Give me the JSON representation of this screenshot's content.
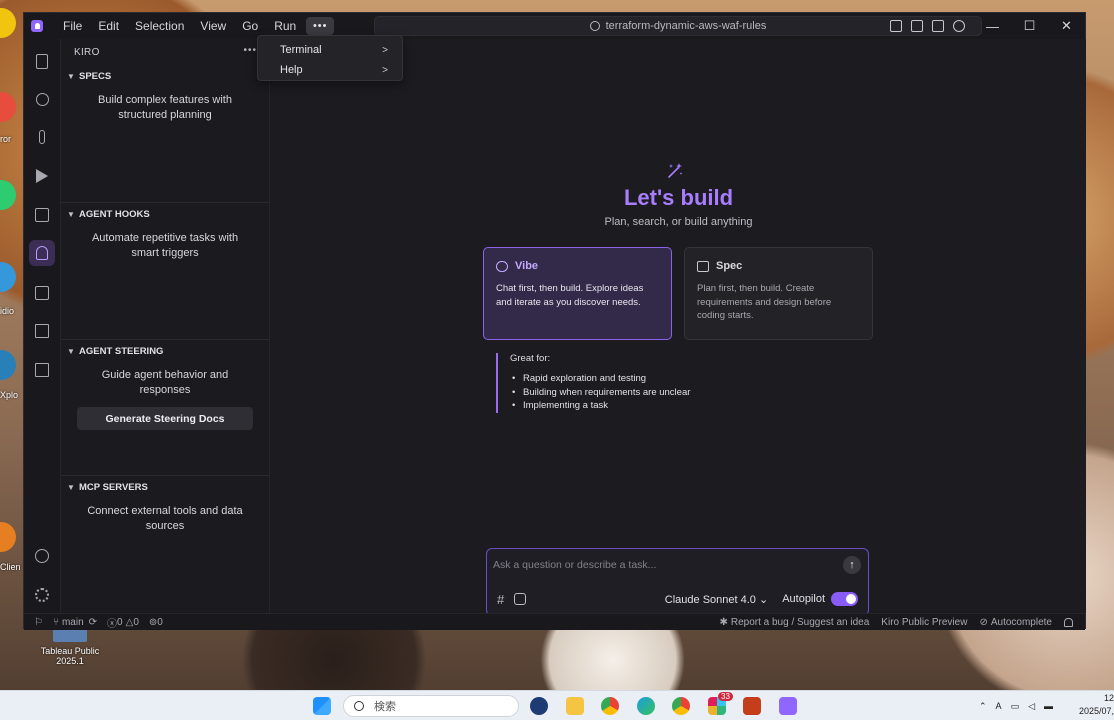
{
  "desktop": {
    "labels": [
      "Tableau Public",
      "2025.1",
      "Clien",
      "idio",
      "Xplo",
      "ror"
    ]
  },
  "titlebar": {
    "menu": [
      "File",
      "Edit",
      "Selection",
      "View",
      "Go",
      "Run"
    ],
    "more": "•••",
    "search_text": "terraform-dynamic-aws-waf-rules",
    "back": "←",
    "forward": "→",
    "minimize": "—",
    "maximize": "☐",
    "close": "✕"
  },
  "dropdown": {
    "items": [
      {
        "label": "Terminal",
        "arrow": ">"
      },
      {
        "label": "Help",
        "arrow": ">"
      }
    ]
  },
  "sidebar": {
    "title": "KIRO",
    "more": "•••",
    "sections": [
      {
        "title": "SPECS",
        "desc": "Build complex features with structured planning"
      },
      {
        "title": "AGENT HOOKS",
        "desc": "Automate repetitive tasks with smart triggers"
      },
      {
        "title": "AGENT STEERING",
        "desc": "Guide agent behavior and responses",
        "button": "Generate Steering Docs"
      },
      {
        "title": "MCP SERVERS",
        "desc": "Connect external tools and data sources"
      }
    ]
  },
  "editor": {
    "headline": "Let's build",
    "subtitle": "Plan, search, or build anything",
    "cards": {
      "vibe": {
        "title": "Vibe",
        "desc": "Chat first, then build. Explore ideas and iterate as you discover needs."
      },
      "spec": {
        "title": "Spec",
        "desc": "Plan first, then build. Create requirements and design before coding starts."
      }
    },
    "great_for": {
      "title": "Great for:",
      "items": [
        "Rapid exploration and testing",
        "Building when requirements are unclear",
        "Implementing a task"
      ]
    },
    "chat": {
      "placeholder": "Ask a question or describe a task...",
      "send": "↑",
      "hash": "#",
      "model": "Claude Sonnet 4.0 ⌄",
      "autopilot": "Autopilot",
      "autopilot_on": true
    }
  },
  "statusbar": {
    "branch": "main",
    "errors": "0",
    "warnings": "0",
    "ports": "0",
    "report": "Report a bug / Suggest an idea",
    "preview": "Kiro Public Preview",
    "autocomplete": "Autocomplete"
  },
  "taskbar": {
    "search_placeholder": "検索",
    "badge": "33",
    "clock_time": "12",
    "clock_date": "2025/07,"
  },
  "colors": {
    "accent": "#a97dff",
    "vibe_border": "#8a63e8",
    "editor_bg": "#1c1b20"
  }
}
